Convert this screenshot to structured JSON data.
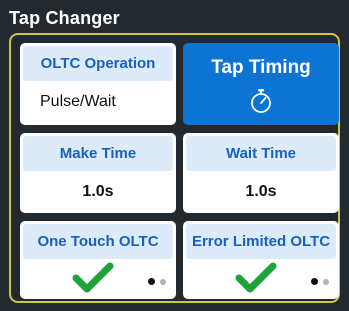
{
  "panel": {
    "title": "Tap Changer"
  },
  "tiles": {
    "oltc_operation": {
      "label": "OLTC Operation",
      "value": "Pulse/Wait",
      "selected_option": 1,
      "option_count": 2
    },
    "tap_timing": {
      "label": "Tap Timing",
      "icon": "timer-icon"
    },
    "make_time": {
      "label": "Make Time",
      "value": "1.0s"
    },
    "wait_time": {
      "label": "Wait Time",
      "value": "1.0s"
    },
    "one_touch_oltc": {
      "label": "One Touch OLTC",
      "checked": true,
      "selected_option": 1,
      "option_count": 2,
      "icon": "checkmark-icon"
    },
    "error_limited_oltc": {
      "label": "Error Limited OLTC",
      "checked": true,
      "selected_option": 1,
      "option_count": 2,
      "icon": "checkmark-icon"
    }
  },
  "colors": {
    "panel_bg": "#222a30",
    "frame_border": "#c9c94a",
    "tile_header_bg": "#ddeaf8",
    "tile_header_text": "#1761c1",
    "active_tile_bg": "#0d74d4",
    "check_green": "#1ea33a"
  }
}
